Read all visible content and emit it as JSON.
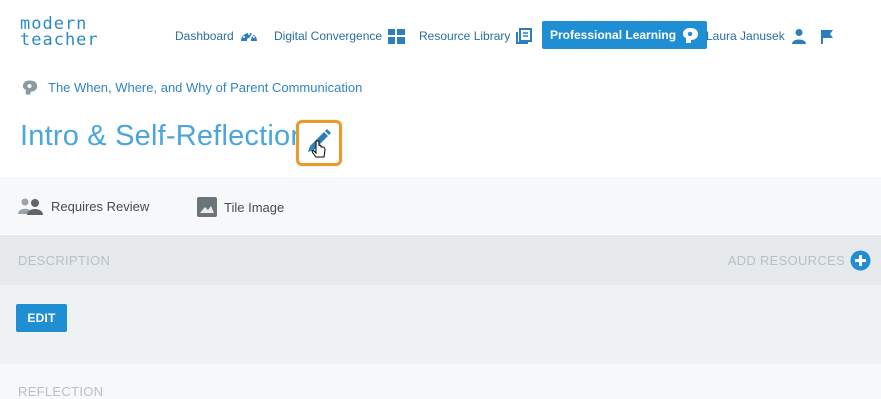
{
  "logo": {
    "line1": "modern",
    "line2": "teacher"
  },
  "nav": {
    "dashboard": "Dashboard",
    "digital_convergence": "Digital Convergence",
    "resource_library": "Resource Library",
    "professional_learning": "Professional Learning",
    "user": "Laura Janusek"
  },
  "breadcrumb": "The When, Where, and Why of Parent Communication",
  "page_title": "Intro & Self-Reflection",
  "toolbar": {
    "requires_review": "Requires Review",
    "tile_image": "Tile Image"
  },
  "sections": {
    "description": "DESCRIPTION",
    "add_resources": "ADD RESOURCES",
    "edit": "EDIT",
    "reflection": "REFLECTION"
  },
  "colors": {
    "brand_blue": "#1f8ed3",
    "title_blue": "#4aa6dc",
    "highlight_orange": "#e99a2b"
  },
  "icons": [
    "dashboard-gauge-icon",
    "grid-icon",
    "library-icon",
    "brain-icon",
    "user-icon",
    "flag-icon",
    "pencil-icon",
    "users-icon",
    "image-icon",
    "plus-circle-icon",
    "hand-cursor-icon"
  ]
}
